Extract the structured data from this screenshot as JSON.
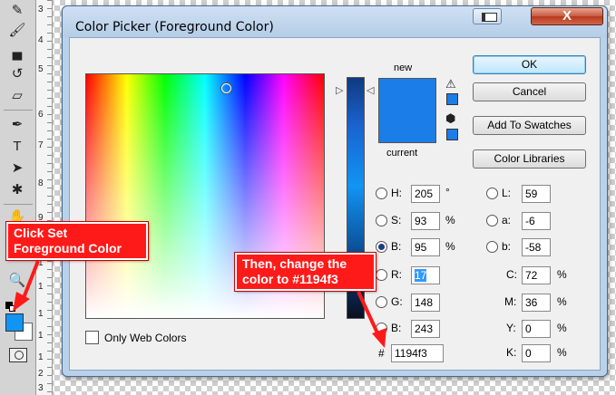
{
  "toolbar": {
    "tools": [
      {
        "icon": "healing-brush-icon",
        "glyph": "✎"
      },
      {
        "icon": "brush-icon",
        "glyph": "🖌"
      },
      {
        "icon": "clone-stamp-icon",
        "glyph": "▄"
      },
      {
        "icon": "history-brush-icon",
        "glyph": "↺"
      },
      {
        "icon": "eraser-icon",
        "glyph": "▱"
      },
      {
        "icon": "gradient-icon",
        "glyph": "▣"
      },
      {
        "icon": "blur-icon",
        "glyph": "💧"
      },
      {
        "icon": "dodge-icon",
        "glyph": "🔍"
      },
      {
        "icon": "pen-icon",
        "glyph": "✒"
      },
      {
        "icon": "type-icon",
        "glyph": "T"
      },
      {
        "icon": "path-selection-icon",
        "glyph": "➤"
      },
      {
        "icon": "custom-shape-icon",
        "glyph": "✱"
      },
      {
        "icon": "hand-icon",
        "glyph": "✋"
      },
      {
        "icon": "zoom-icon",
        "glyph": "🔍"
      }
    ],
    "foreground_color": "#1194f3",
    "background_color": "#ffffff"
  },
  "ruler": {
    "numbers": [
      "3",
      "4",
      "5",
      "6",
      "7",
      "8",
      "9",
      "1",
      "1",
      "1",
      "1",
      "1",
      "2",
      "3"
    ]
  },
  "dialog": {
    "title": "Color Picker (Foreground Color)",
    "close_label": "X",
    "field_cursor_color": "#ffffff",
    "only_web_colors_label": "Only Web Colors",
    "only_web_colors_checked": false,
    "preview": {
      "new_label": "new",
      "current_label": "current",
      "new_color": "#1a7de8",
      "current_color": "#1a7de8",
      "gamut_swatch_color": "#1a7de8",
      "web_swatch_color": "#1a7de8"
    },
    "buttons": {
      "ok": "OK",
      "cancel": "Cancel",
      "add_to_swatches": "Add To Swatches",
      "color_libraries": "Color Libraries"
    },
    "hsb": {
      "h_label": "H:",
      "h_value": "205",
      "h_unit": "°",
      "s_label": "S:",
      "s_value": "93",
      "s_unit": "%",
      "b_label": "B:",
      "b_value": "95",
      "b_unit": "%",
      "selected": "B"
    },
    "lab": {
      "l_label": "L:",
      "l_value": "59",
      "a_label": "a:",
      "a_value": "-6",
      "b_label": "b:",
      "b_value": "-58"
    },
    "rgb": {
      "r_label": "R:",
      "r_value": "17",
      "g_label": "G:",
      "g_value": "148",
      "b_label": "B:",
      "b_value": "243"
    },
    "cmyk": {
      "c_label": "C:",
      "c_value": "72",
      "c_unit": "%",
      "m_label": "M:",
      "m_value": "36",
      "m_unit": "%",
      "y_label": "Y:",
      "y_value": "0",
      "y_unit": "%",
      "k_label": "K:",
      "k_value": "0",
      "k_unit": "%"
    },
    "hex": {
      "label": "#",
      "value": "1194f3"
    }
  },
  "annotations": {
    "callout_1_line_1": "Click Set",
    "callout_1_line_2": "Foreground Color",
    "callout_2_line_1": "Then, change the",
    "callout_2_line_2": "color to #1194f3",
    "color": "#ff1a1a"
  }
}
